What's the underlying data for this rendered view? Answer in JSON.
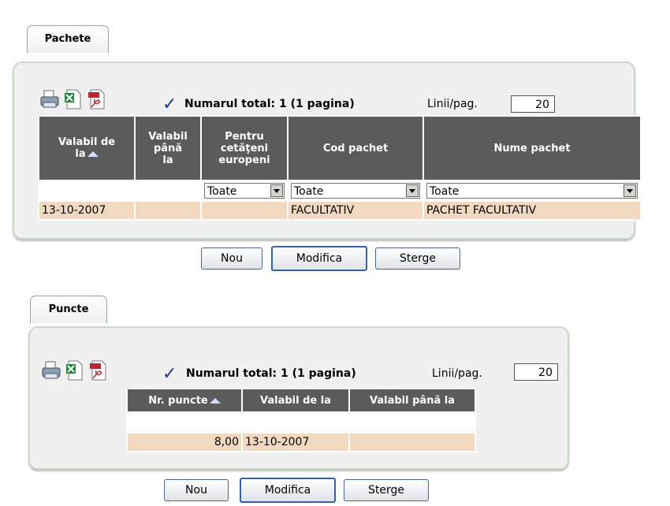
{
  "pachete": {
    "tab_label": "Pachete",
    "total_label": "Numarul total: 1 (1 pagina)",
    "lines_label": "Linii/pag.",
    "lines_value": "20",
    "columns": [
      "Valabil de la",
      "Valabil până la",
      "Pentru cetăţeni europeni",
      "Cod pachet",
      "Nume pachet"
    ],
    "col_lines": {
      "c0": [
        "Valabil de",
        "la"
      ],
      "c1": [
        "Valabil",
        "până",
        "la"
      ],
      "c2": [
        "Pentru",
        "cetăţeni",
        "europeni"
      ]
    },
    "filters": {
      "pentru": "Toate",
      "cod": "Toate",
      "nume": "Toate"
    },
    "rows": [
      {
        "valabil_de_la": "13-10-2007",
        "valabil_pana_la": "",
        "pentru": "",
        "cod": "FACULTATIV",
        "nume": "PACHET FACULTATIV"
      }
    ],
    "buttons": {
      "nou": "Nou",
      "modifica": "Modifica",
      "sterge": "Sterge"
    }
  },
  "puncte": {
    "tab_label": "Puncte",
    "total_label": "Numarul total: 1 (1 pagina)",
    "lines_label": "Linii/pag.",
    "lines_value": "20",
    "columns": [
      "Nr. puncte",
      "Valabil de la",
      "Valabil până la"
    ],
    "rows": [
      {
        "nr_puncte": "8,00",
        "valabil_de_la": "13-10-2007",
        "valabil_pana_la": ""
      }
    ],
    "buttons": {
      "nou": "Nou",
      "modifica": "Modifica",
      "sterge": "Sterge"
    }
  },
  "icons": [
    "printer-icon",
    "excel-icon",
    "pdf-icon",
    "checkmark-icon",
    "sort-ascending-icon",
    "dropdown-arrow-icon"
  ],
  "colors": {
    "header_bg": "#5b5b5b",
    "row_bg": "#f1d9c0",
    "panel_bg": "#f0f0f0",
    "panel_border": "#c9d9c4"
  }
}
